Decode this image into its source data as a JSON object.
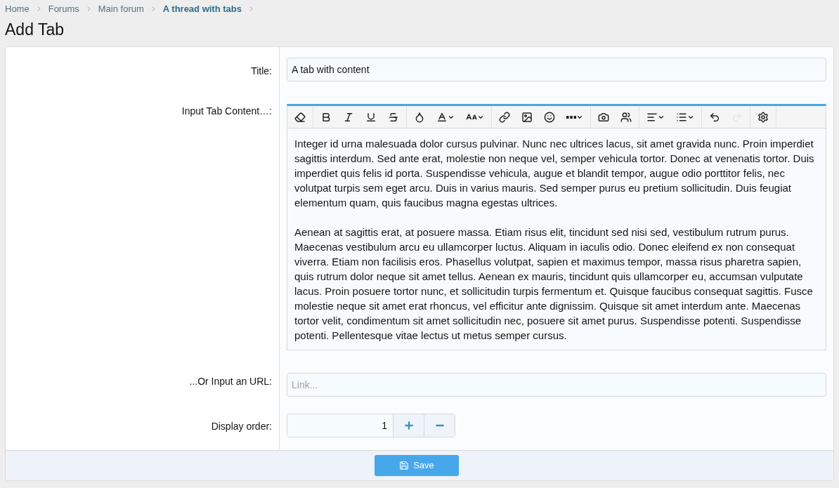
{
  "breadcrumb": [
    {
      "label": "Home",
      "current": false
    },
    {
      "label": "Forums",
      "current": false
    },
    {
      "label": "Main forum",
      "current": false
    },
    {
      "label": "A thread with tabs",
      "current": true
    }
  ],
  "page_title": "Add Tab",
  "title_field": {
    "label": "Title:",
    "value": "A tab with content"
  },
  "content_editor": {
    "label": "Input Tab Content…:",
    "toolbar": [
      [
        {
          "dropdown": false,
          "disabled": false
        }
      ],
      [
        {
          "dropdown": false,
          "disabled": false
        },
        {
          "dropdown": false,
          "disabled": false
        },
        {
          "dropdown": false,
          "disabled": false
        },
        {
          "dropdown": false,
          "disabled": false
        }
      ],
      [
        {
          "dropdown": false,
          "disabled": false
        },
        {
          "dropdown": true,
          "disabled": false
        },
        {
          "dropdown": true,
          "disabled": false
        }
      ],
      [
        {
          "dropdown": false,
          "disabled": false
        },
        {
          "dropdown": false,
          "disabled": false
        },
        {
          "dropdown": false,
          "disabled": false
        },
        {
          "dropdown": true,
          "disabled": false
        }
      ],
      [
        {
          "dropdown": false,
          "disabled": false
        },
        {
          "dropdown": false,
          "disabled": false
        }
      ],
      [
        {
          "dropdown": true,
          "disabled": false
        },
        {
          "dropdown": true,
          "disabled": false
        }
      ],
      [
        {
          "dropdown": false,
          "disabled": false
        },
        {
          "dropdown": false,
          "disabled": true
        }
      ],
      [
        {
          "dropdown": false,
          "disabled": false
        }
      ]
    ],
    "paragraphs": [
      "Integer id urna malesuada dolor cursus pulvinar. Nunc nec ultrices lacus, sit amet gravida nunc. Proin imperdiet sagittis interdum. Sed ante erat, molestie non neque vel, semper vehicula tortor. Donec at venenatis tortor. Duis imperdiet quis felis id porta. Suspendisse vehicula, augue et blandit tempor, augue odio porttitor felis, nec volutpat turpis sem eget arcu. Duis in varius mauris. Sed semper purus eu pretium sollicitudin. Duis feugiat elementum quam, quis faucibus magna egestas ultrices.",
      "Aenean at sagittis erat, at posuere massa. Etiam risus elit, tincidunt sed nisi sed, vestibulum rutrum purus. Maecenas vestibulum arcu eu ullamcorper luctus. Aliquam in iaculis odio. Donec eleifend ex non consequat viverra. Etiam non facilisis eros. Phasellus volutpat, sapien et maximus tempor, massa risus pharetra sapien, quis rutrum dolor neque sit amet tellus. Aenean ex mauris, tincidunt quis ullamcorper eu, accumsan vulputate lacus. Proin posuere tortor nunc, et sollicitudin turpis fermentum et. Quisque faucibus consequat sagittis. Fusce molestie neque sit amet erat rhoncus, vel efficitur ante dignissim. Quisque sit amet interdum ante. Maecenas tortor velit, condimentum sit amet sollicitudin nec, posuere sit amet purus. Suspendisse potenti. Suspendisse potenti. Pellentesque vitae lectus ut metus semper cursus."
    ]
  },
  "url_field": {
    "label": "...Or Input an URL:",
    "placeholder": "Link..."
  },
  "display_order": {
    "label": "Display order:",
    "value": "1"
  },
  "save_button": "Save"
}
